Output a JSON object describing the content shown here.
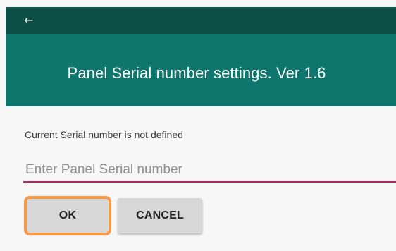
{
  "header": {
    "back_icon": "back-arrow-icon",
    "back_glyph": "←",
    "title": "Panel Serial number settings. Ver 1.6"
  },
  "content": {
    "status_text": "Current Serial number is not defined",
    "serial_input": {
      "value": "",
      "placeholder": "Enter Panel Serial number"
    }
  },
  "buttons": {
    "ok_label": "OK",
    "cancel_label": "CANCEL"
  },
  "colors": {
    "status_bar": "#0b4f47",
    "header": "#0f766d",
    "input_underline": "#c61e5a",
    "focus_outline": "#f29a48",
    "button_background": "#d7d7d7"
  }
}
